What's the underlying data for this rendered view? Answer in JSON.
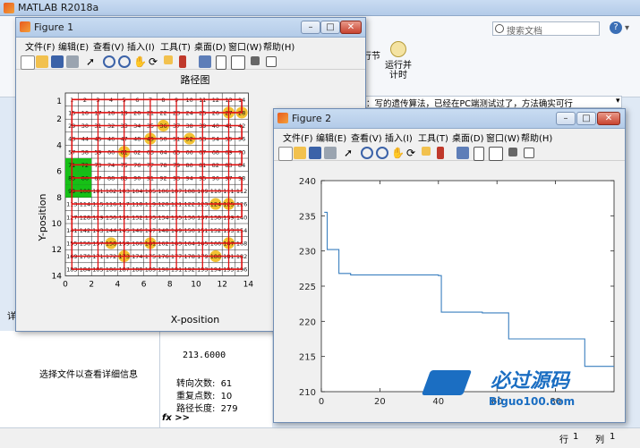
{
  "matlab": {
    "title": "MATLAB R2018a",
    "search_placeholder": "搜索文档",
    "ribbon_labels": [
      "行节",
      "运行并\n计时"
    ],
    "hint_text": "：写的遗传算法，已经在PC端测试过了，方法确实可行",
    "file_detail_text": "选择文件以查看详细信息",
    "left_char": "详",
    "prompt": "fx >>",
    "status": {
      "row_label": "行",
      "row_value": "1",
      "col_label": "列",
      "col_value": "1"
    }
  },
  "command_output": {
    "value": "213.6000",
    "lines": [
      {
        "label": "转向次数:",
        "value": "61"
      },
      {
        "label": "重复点数:",
        "value": "10"
      },
      {
        "label": "路径长度:",
        "value": "279"
      }
    ]
  },
  "figure1": {
    "title": "Figure 1",
    "menu": [
      "文件(F)",
      "编辑(E)",
      "查看(V)",
      "插入(I)",
      "工具(T)",
      "桌面(D)",
      "窗口(W)",
      "帮助(H)"
    ],
    "plot_title": "路径图",
    "xlabel": "X-position",
    "ylabel": "Y-position",
    "xticks": [
      "0",
      "2",
      "4",
      "6",
      "8",
      "10",
      "12",
      "14"
    ],
    "yticks": [
      "1",
      "2",
      "4",
      "6",
      "8",
      "10",
      "12",
      "14"
    ]
  },
  "figure2": {
    "title": "Figure 2",
    "menu": [
      "文件(F)",
      "编辑(E)",
      "查看(V)",
      "插入(I)",
      "工具(T)",
      "桌面(D)",
      "窗口(W)",
      "帮助(H)"
    ]
  },
  "watermark": {
    "name": "必过源码",
    "url": "Biguo100.com"
  },
  "colors": {
    "path": "#e01010",
    "obstacle": "#f2c233",
    "start_region": "#16c016",
    "line": "#3a7fbf"
  },
  "chart_data": {
    "type": "line",
    "title": "",
    "xlabel": "",
    "ylabel": "",
    "xlim": [
      0,
      100
    ],
    "ylim": [
      210,
      240
    ],
    "xticks": [
      "0",
      "20",
      "40",
      "60",
      "80"
    ],
    "yticks": [
      "210",
      "215",
      "220",
      "225",
      "230",
      "235",
      "240"
    ],
    "series": [
      {
        "x": [
          1,
          2,
          2,
          6,
          6,
          10,
          10,
          40,
          40,
          41,
          41,
          55,
          55,
          64,
          64,
          90,
          90,
          100
        ],
        "y": [
          235.5,
          235.5,
          230.2,
          230.2,
          226.8,
          226.8,
          226.6,
          226.6,
          226.5,
          226.5,
          221.3,
          221.3,
          221.2,
          221.2,
          217.5,
          217.5,
          213.6,
          213.6
        ]
      }
    ]
  }
}
